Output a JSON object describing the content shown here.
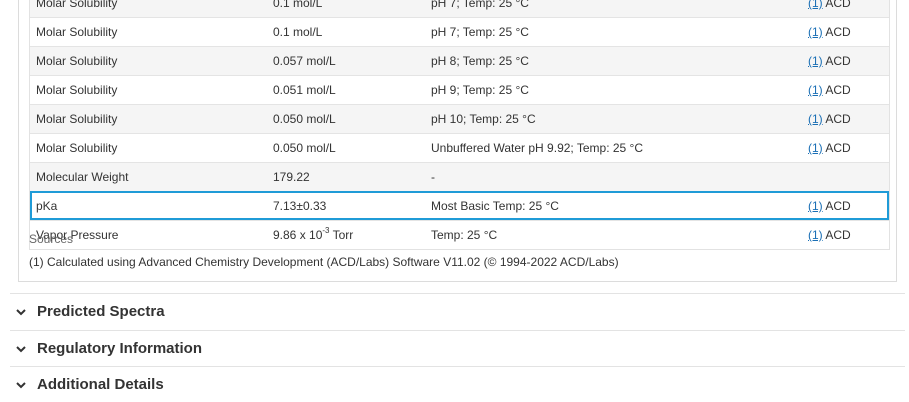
{
  "table": {
    "rows": [
      {
        "property": "Molar Solubility",
        "value": "0.1 mol/L",
        "conditions": "pH 7; Temp: 25 °C",
        "ref": "(1)",
        "source": "ACD"
      },
      {
        "property": "Molar Solubility",
        "value": "0.057 mol/L",
        "conditions": "pH 8; Temp: 25 °C",
        "ref": "(1)",
        "source": "ACD"
      },
      {
        "property": "Molar Solubility",
        "value": "0.051 mol/L",
        "conditions": "pH 9; Temp: 25 °C",
        "ref": "(1)",
        "source": "ACD"
      },
      {
        "property": "Molar Solubility",
        "value": "0.050 mol/L",
        "conditions": "pH 10; Temp: 25 °C",
        "ref": "(1)",
        "source": "ACD"
      },
      {
        "property": "Molar Solubility",
        "value": "0.050 mol/L",
        "conditions": "Unbuffered Water pH 9.92; Temp: 25 °C",
        "ref": "(1)",
        "source": "ACD"
      },
      {
        "property": "Molecular Weight",
        "value": "179.22",
        "conditions": "-",
        "ref": "",
        "source": ""
      },
      {
        "property": "pKa",
        "value": "7.13±0.33",
        "conditions": "Most Basic Temp: 25 °C",
        "ref": "(1)",
        "source": "ACD"
      },
      {
        "property": "Vapor Pressure",
        "value_prefix": "9.86 x 10",
        "value_exp": "-3",
        "value_suffix": " Torr",
        "conditions": "Temp: 25 °C",
        "ref": "(1)",
        "source": "ACD"
      }
    ]
  },
  "sources": {
    "label": "Sources",
    "items": [
      "(1) Calculated using Advanced Chemistry Development (ACD/Labs) Software V11.02 (© 1994-2022 ACD/Labs)"
    ]
  },
  "sections": [
    {
      "title": "Predicted Spectra"
    },
    {
      "title": "Regulatory Information"
    },
    {
      "title": "Additional Details"
    }
  ],
  "colors": {
    "highlight": "#1f9bd7",
    "link": "#1a6fb5"
  }
}
